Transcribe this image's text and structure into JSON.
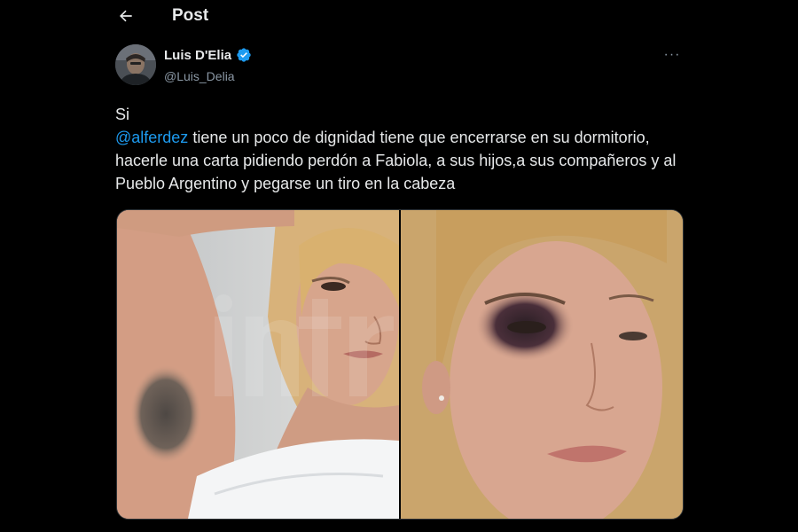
{
  "header": {
    "back_icon": "arrow-left-icon",
    "title": "Post"
  },
  "tweet": {
    "author": {
      "name": "Luis D'Elia",
      "handle": "@Luis_Delia",
      "verified": true,
      "verified_icon": "verified-badge-icon"
    },
    "more_icon": "more-horizontal-icon",
    "more_label": "···",
    "text": {
      "line1": "Si",
      "mention": "@alferdez",
      "body": " tiene un poco de dignidad tiene que encerrarse en su dormitorio, hacerle una carta pidiendo perdón a Fabiola, a sus hijos,a sus compañeros y al Pueblo Argentino y pegarse un tiro en la cabeza"
    },
    "media": {
      "images": [
        {
          "subject": "woman raising arm showing bruised forearm"
        },
        {
          "subject": "close-up of woman's face with black eye"
        }
      ]
    }
  },
  "colors": {
    "background": "#000000",
    "text": "#e7e9ea",
    "secondary": "#8b98a5",
    "accent": "#1d9bf0"
  }
}
